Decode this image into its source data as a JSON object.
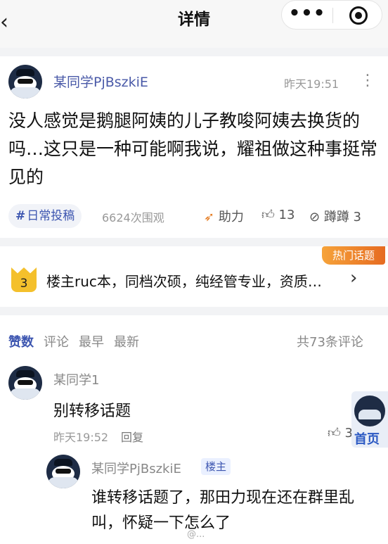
{
  "header": {
    "back_icon": "‹",
    "title": "详情",
    "more_icon": "•••",
    "close_icon": "target-icon"
  },
  "post": {
    "author": "某同学PjBszkiE",
    "time": "昨天19:51",
    "more": "⋮",
    "text": "没人感觉是鹅腿阿姨的儿子教唆阿姨去换货的吗…这只是一种可能啊我说，耀祖做这种事挺常见的",
    "tag": "日常投稿",
    "tag_symbol": "#",
    "views": "6624次围观",
    "boost_label": "助力",
    "likes": "13",
    "steps": "蹲蹲 3"
  },
  "hot_topic": {
    "badge": "热门话题",
    "rank": "3",
    "text": "楼主ruc本，同档次硕，纯经管专业，资质…",
    "arrow": "›"
  },
  "comments": {
    "sort_tabs": [
      "赞数",
      "评论",
      "最早",
      "最新"
    ],
    "count": "共73条评论",
    "items": [
      {
        "author": "某同学1",
        "text": "别转移话题",
        "time": "昨天19:52",
        "reply": "回复",
        "likes": "3"
      },
      {
        "author": "某同学PjBszkiE",
        "badge": "楼主",
        "text": "谁转移话题了，那田力现在还在群里乱叫，怀疑一下怎么了"
      }
    ]
  },
  "float_home": {
    "label": "首页"
  },
  "watermark": "@..."
}
